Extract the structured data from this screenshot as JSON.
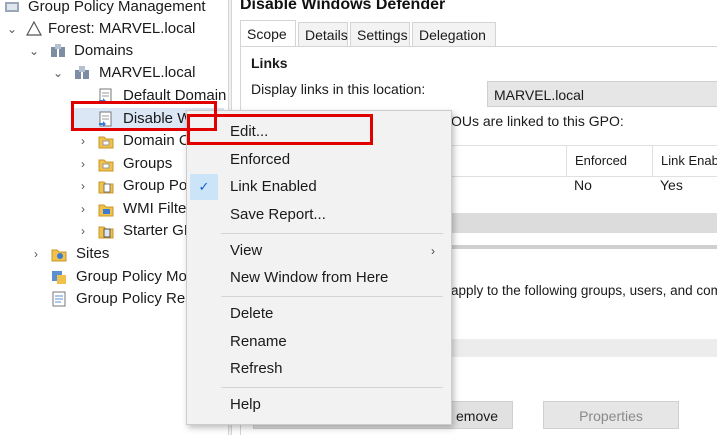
{
  "tree": {
    "items": [
      {
        "label": "Group Policy Management",
        "icon": "gpm-console-icon",
        "expander": ""
      },
      {
        "label": "Forest: MARVEL.local",
        "icon": "forest-icon",
        "expander": "⌄"
      },
      {
        "label": "Domains",
        "icon": "domains-icon",
        "expander": "⌄"
      },
      {
        "label": "MARVEL.local",
        "icon": "domain-icon",
        "expander": "⌄"
      },
      {
        "label": "Default Domain",
        "icon": "gpo-link-icon",
        "expander": ""
      },
      {
        "label": "Disable W",
        "icon": "gpo-link-icon",
        "expander": ""
      },
      {
        "label": "Domain C",
        "icon": "ou-folder-icon",
        "expander": "›"
      },
      {
        "label": "Groups",
        "icon": "ou-folder-icon",
        "expander": "›"
      },
      {
        "label": "Group Po",
        "icon": "gpo-folder-icon",
        "expander": "›"
      },
      {
        "label": "WMI Filte",
        "icon": "wmi-folder-icon",
        "expander": "›"
      },
      {
        "label": "Starter GP",
        "icon": "starter-gpo-folder-icon",
        "expander": "›"
      },
      {
        "label": "Sites",
        "icon": "sites-icon",
        "expander": "›"
      },
      {
        "label": "Group Policy Mo",
        "icon": "modeling-icon",
        "expander": ""
      },
      {
        "label": "Group Policy Res",
        "icon": "results-icon",
        "expander": ""
      }
    ]
  },
  "details": {
    "title": "Disable Windows Defender",
    "tabs": [
      {
        "label": "Scope"
      },
      {
        "label": "Details"
      },
      {
        "label": "Settings"
      },
      {
        "label": "Delegation"
      }
    ],
    "links_heading": "Links",
    "display_links_label": "Display links in this location:",
    "location_value": "MARVEL.local",
    "linked_text": "OUs are linked to this GPO:",
    "columns": {
      "enforced": "Enforced",
      "link_enabled": "Link Enab"
    },
    "row": {
      "enforced": "No",
      "link_enabled": "Yes"
    },
    "filter_text": "apply to the following groups, users, and comp",
    "remove_button": "emove",
    "properties_button": "Properties"
  },
  "context_menu": {
    "edit": "Edit...",
    "enforced": "Enforced",
    "link_enabled": "Link Enabled",
    "save_report": "Save Report...",
    "view": "View",
    "new_window": "New Window from Here",
    "delete": "Delete",
    "rename": "Rename",
    "refresh": "Refresh",
    "help": "Help",
    "check_glyph": "✓",
    "submenu_glyph": "›"
  },
  "colors": {
    "highlight_box": "#e00000",
    "menu_background": "#f2f2f2",
    "check_background": "#cce4f7",
    "disabled_text": "#8a8a8a"
  }
}
